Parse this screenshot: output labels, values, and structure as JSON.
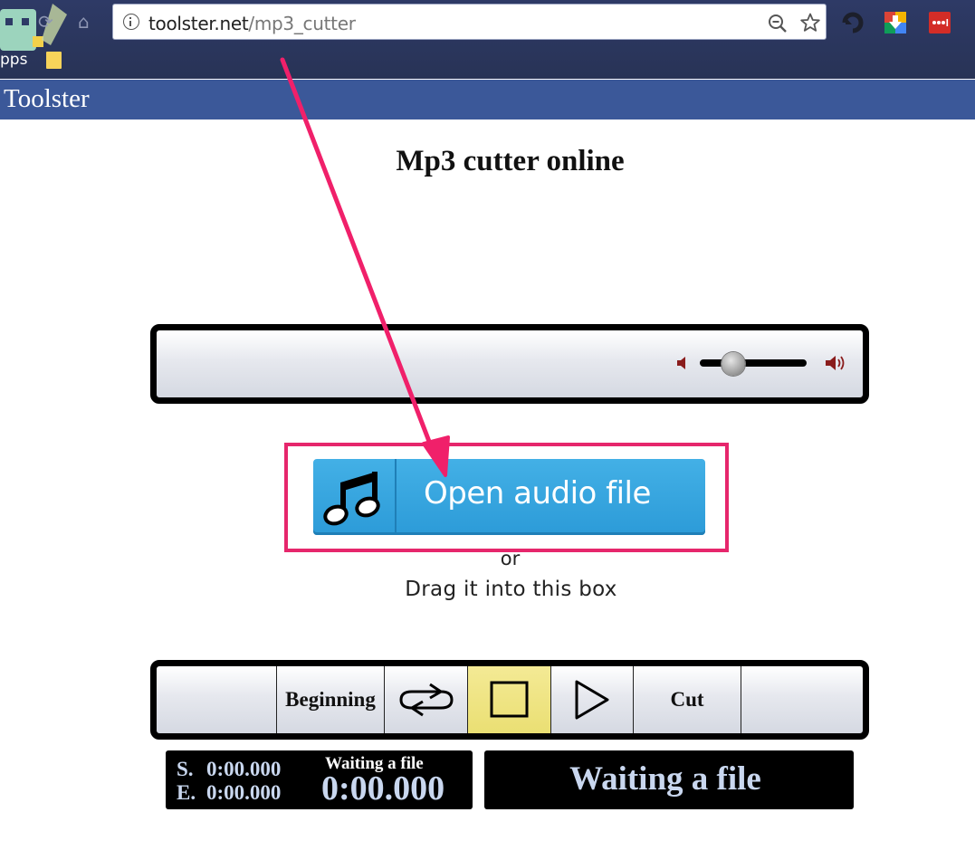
{
  "browser": {
    "url_host": "toolster.net",
    "url_path": "/mp3_cutter",
    "bookmarks_label": "pps"
  },
  "site": {
    "name": "Toolster"
  },
  "page": {
    "title": "Mp3 cutter online"
  },
  "player": {
    "volume_level": 0.3
  },
  "open_file": {
    "button_label": "Open audio file",
    "or_text": "or",
    "drag_text": "Drag it into this box"
  },
  "controls": {
    "beginning_label": "Beginning",
    "cut_label": "Cut"
  },
  "time": {
    "start_prefix": "S.",
    "start_value": "0:00.000",
    "end_prefix": "E.",
    "end_value": "0:00.000",
    "status_small": "Waiting a file",
    "current_time": "0:00.000"
  },
  "status": {
    "message": "Waiting a file"
  },
  "colors": {
    "header_blue": "#3b5899",
    "button_blue": "#2c9bd8",
    "highlight_pink": "#e6266c",
    "stop_yellow": "#eadf73"
  }
}
